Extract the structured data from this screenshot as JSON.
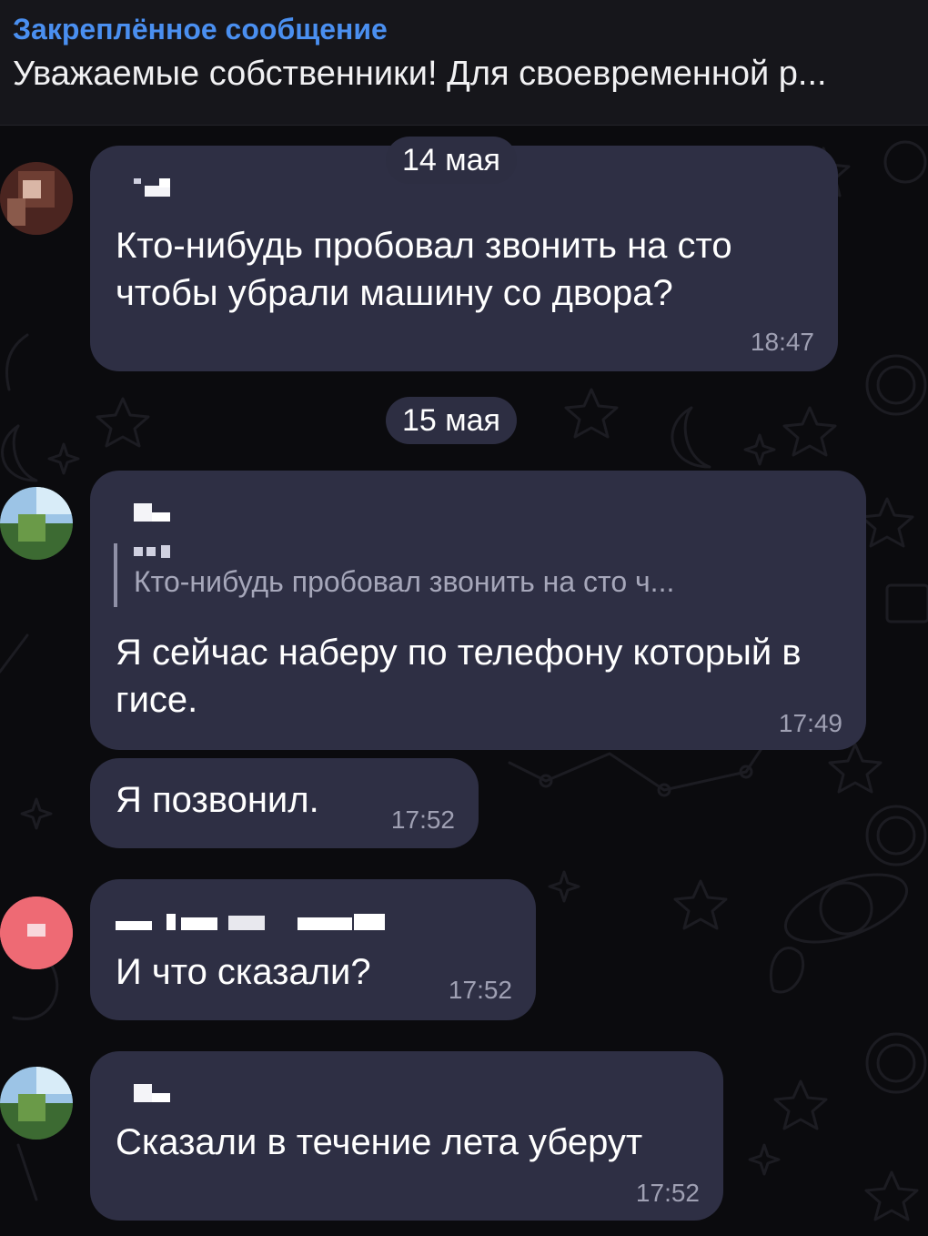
{
  "pinned": {
    "title": "Закреплённое сообщение",
    "text": "Уважаемые собственники! Для своевременной р..."
  },
  "dates": [
    "14 мая",
    "15 мая"
  ],
  "messages": [
    {
      "text": "Кто-нибудь пробовал звонить на сто чтобы убрали машину со двора?",
      "time": "18:47"
    },
    {
      "reply_text": "Кто-нибудь пробовал звонить на сто ч...",
      "text": "Я сейчас наберу по телефону который в гисе.",
      "time": "17:49"
    },
    {
      "text": "Я позвонил.",
      "time": "17:52"
    },
    {
      "text": "И что сказали?",
      "time": "17:52"
    },
    {
      "text": "Сказали в течение лета уберут",
      "time": "17:52"
    }
  ],
  "colors": {
    "background": "#0b0b0e",
    "bubble": "#2e2f44",
    "pinned_title": "#4a8ff0",
    "time": "#9fa0b3"
  },
  "icons": [
    "avatar-blurred",
    "sender-name-pixelated"
  ]
}
